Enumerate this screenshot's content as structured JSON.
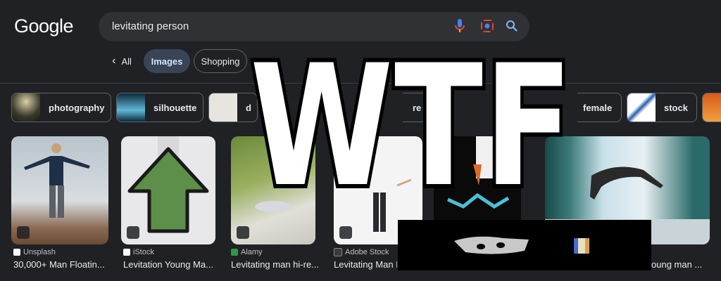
{
  "header": {
    "logo": "Google",
    "search_query": "levitating person"
  },
  "tabs": {
    "all": "All",
    "images": "Images",
    "shopping": "Shopping"
  },
  "chips": [
    {
      "label": "photography"
    },
    {
      "label": "silhouette"
    },
    {
      "label": "d"
    },
    {
      "label": "re"
    },
    {
      "label": "female"
    },
    {
      "label": "stock"
    }
  ],
  "results": [
    {
      "source": "Unsplash",
      "title": "30,000+ Man Floatin..."
    },
    {
      "source": "iStock",
      "title": "Levitation Young Ma..."
    },
    {
      "source": "Alamy",
      "title": "Levitating man hi-re..."
    },
    {
      "source": "Adobe Stock",
      "title": "Levitating Man I"
    },
    {
      "source": "",
      "title": "oung man ..."
    }
  ],
  "overlay": {
    "text": "WTF"
  },
  "colors": {
    "bg": "#202124",
    "accent_arrow": "#5e8f4a",
    "images_tab": "#394457"
  }
}
